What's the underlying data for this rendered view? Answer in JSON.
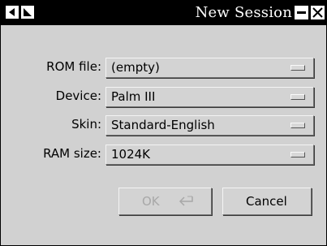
{
  "window": {
    "title": "New Session"
  },
  "form": {
    "rows": [
      {
        "label": "ROM file:",
        "value": "(empty)"
      },
      {
        "label": "Device:",
        "value": "Palm III"
      },
      {
        "label": "Skin:",
        "value": "Standard-English"
      },
      {
        "label": "RAM size:",
        "value": "1024K"
      }
    ]
  },
  "buttons": {
    "ok_label": "OK",
    "ok_enabled": false,
    "cancel_label": "Cancel"
  },
  "colors": {
    "titlebar": "#000000",
    "dialog_bg": "#d1d1d1",
    "disabled_text": "#a8a8a8"
  }
}
